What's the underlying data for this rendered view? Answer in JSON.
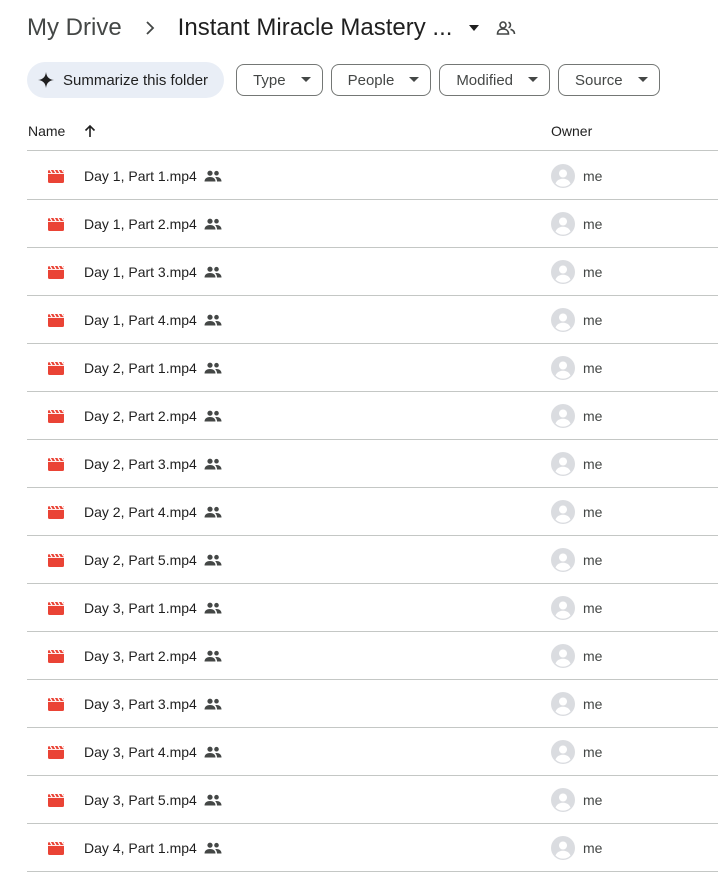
{
  "breadcrumb": {
    "root": "My Drive",
    "current": "Instant Miracle Mastery ..."
  },
  "filters": {
    "summarize_label": "Summarize this folder",
    "chips": [
      "Type",
      "People",
      "Modified",
      "Source"
    ]
  },
  "table": {
    "columns": {
      "name": "Name",
      "owner": "Owner"
    },
    "rows": [
      {
        "name": "Day 1, Part 1.mp4",
        "owner": "me"
      },
      {
        "name": "Day 1, Part 2.mp4",
        "owner": "me"
      },
      {
        "name": "Day 1, Part 3.mp4",
        "owner": "me"
      },
      {
        "name": "Day 1, Part 4.mp4",
        "owner": "me"
      },
      {
        "name": "Day 2, Part 1.mp4",
        "owner": "me"
      },
      {
        "name": "Day 2, Part 2.mp4",
        "owner": "me"
      },
      {
        "name": "Day 2, Part 3.mp4",
        "owner": "me"
      },
      {
        "name": "Day 2, Part 4.mp4",
        "owner": "me"
      },
      {
        "name": "Day 2, Part 5.mp4",
        "owner": "me"
      },
      {
        "name": "Day 3, Part 1.mp4",
        "owner": "me"
      },
      {
        "name": "Day 3, Part 2.mp4",
        "owner": "me"
      },
      {
        "name": "Day 3, Part 3.mp4",
        "owner": "me"
      },
      {
        "name": "Day 3, Part 4.mp4",
        "owner": "me"
      },
      {
        "name": "Day 3, Part 5.mp4",
        "owner": "me"
      },
      {
        "name": "Day 4, Part 1.mp4",
        "owner": "me"
      }
    ]
  },
  "icons": {
    "file": "video-file-icon",
    "shared": "shared-people-icon",
    "avatar": "avatar-icon",
    "sort": "arrow-up-icon"
  },
  "colors": {
    "video_icon": "#ea4335",
    "summarize_bg": "#e9eef6",
    "divider": "#c4c7c5"
  }
}
